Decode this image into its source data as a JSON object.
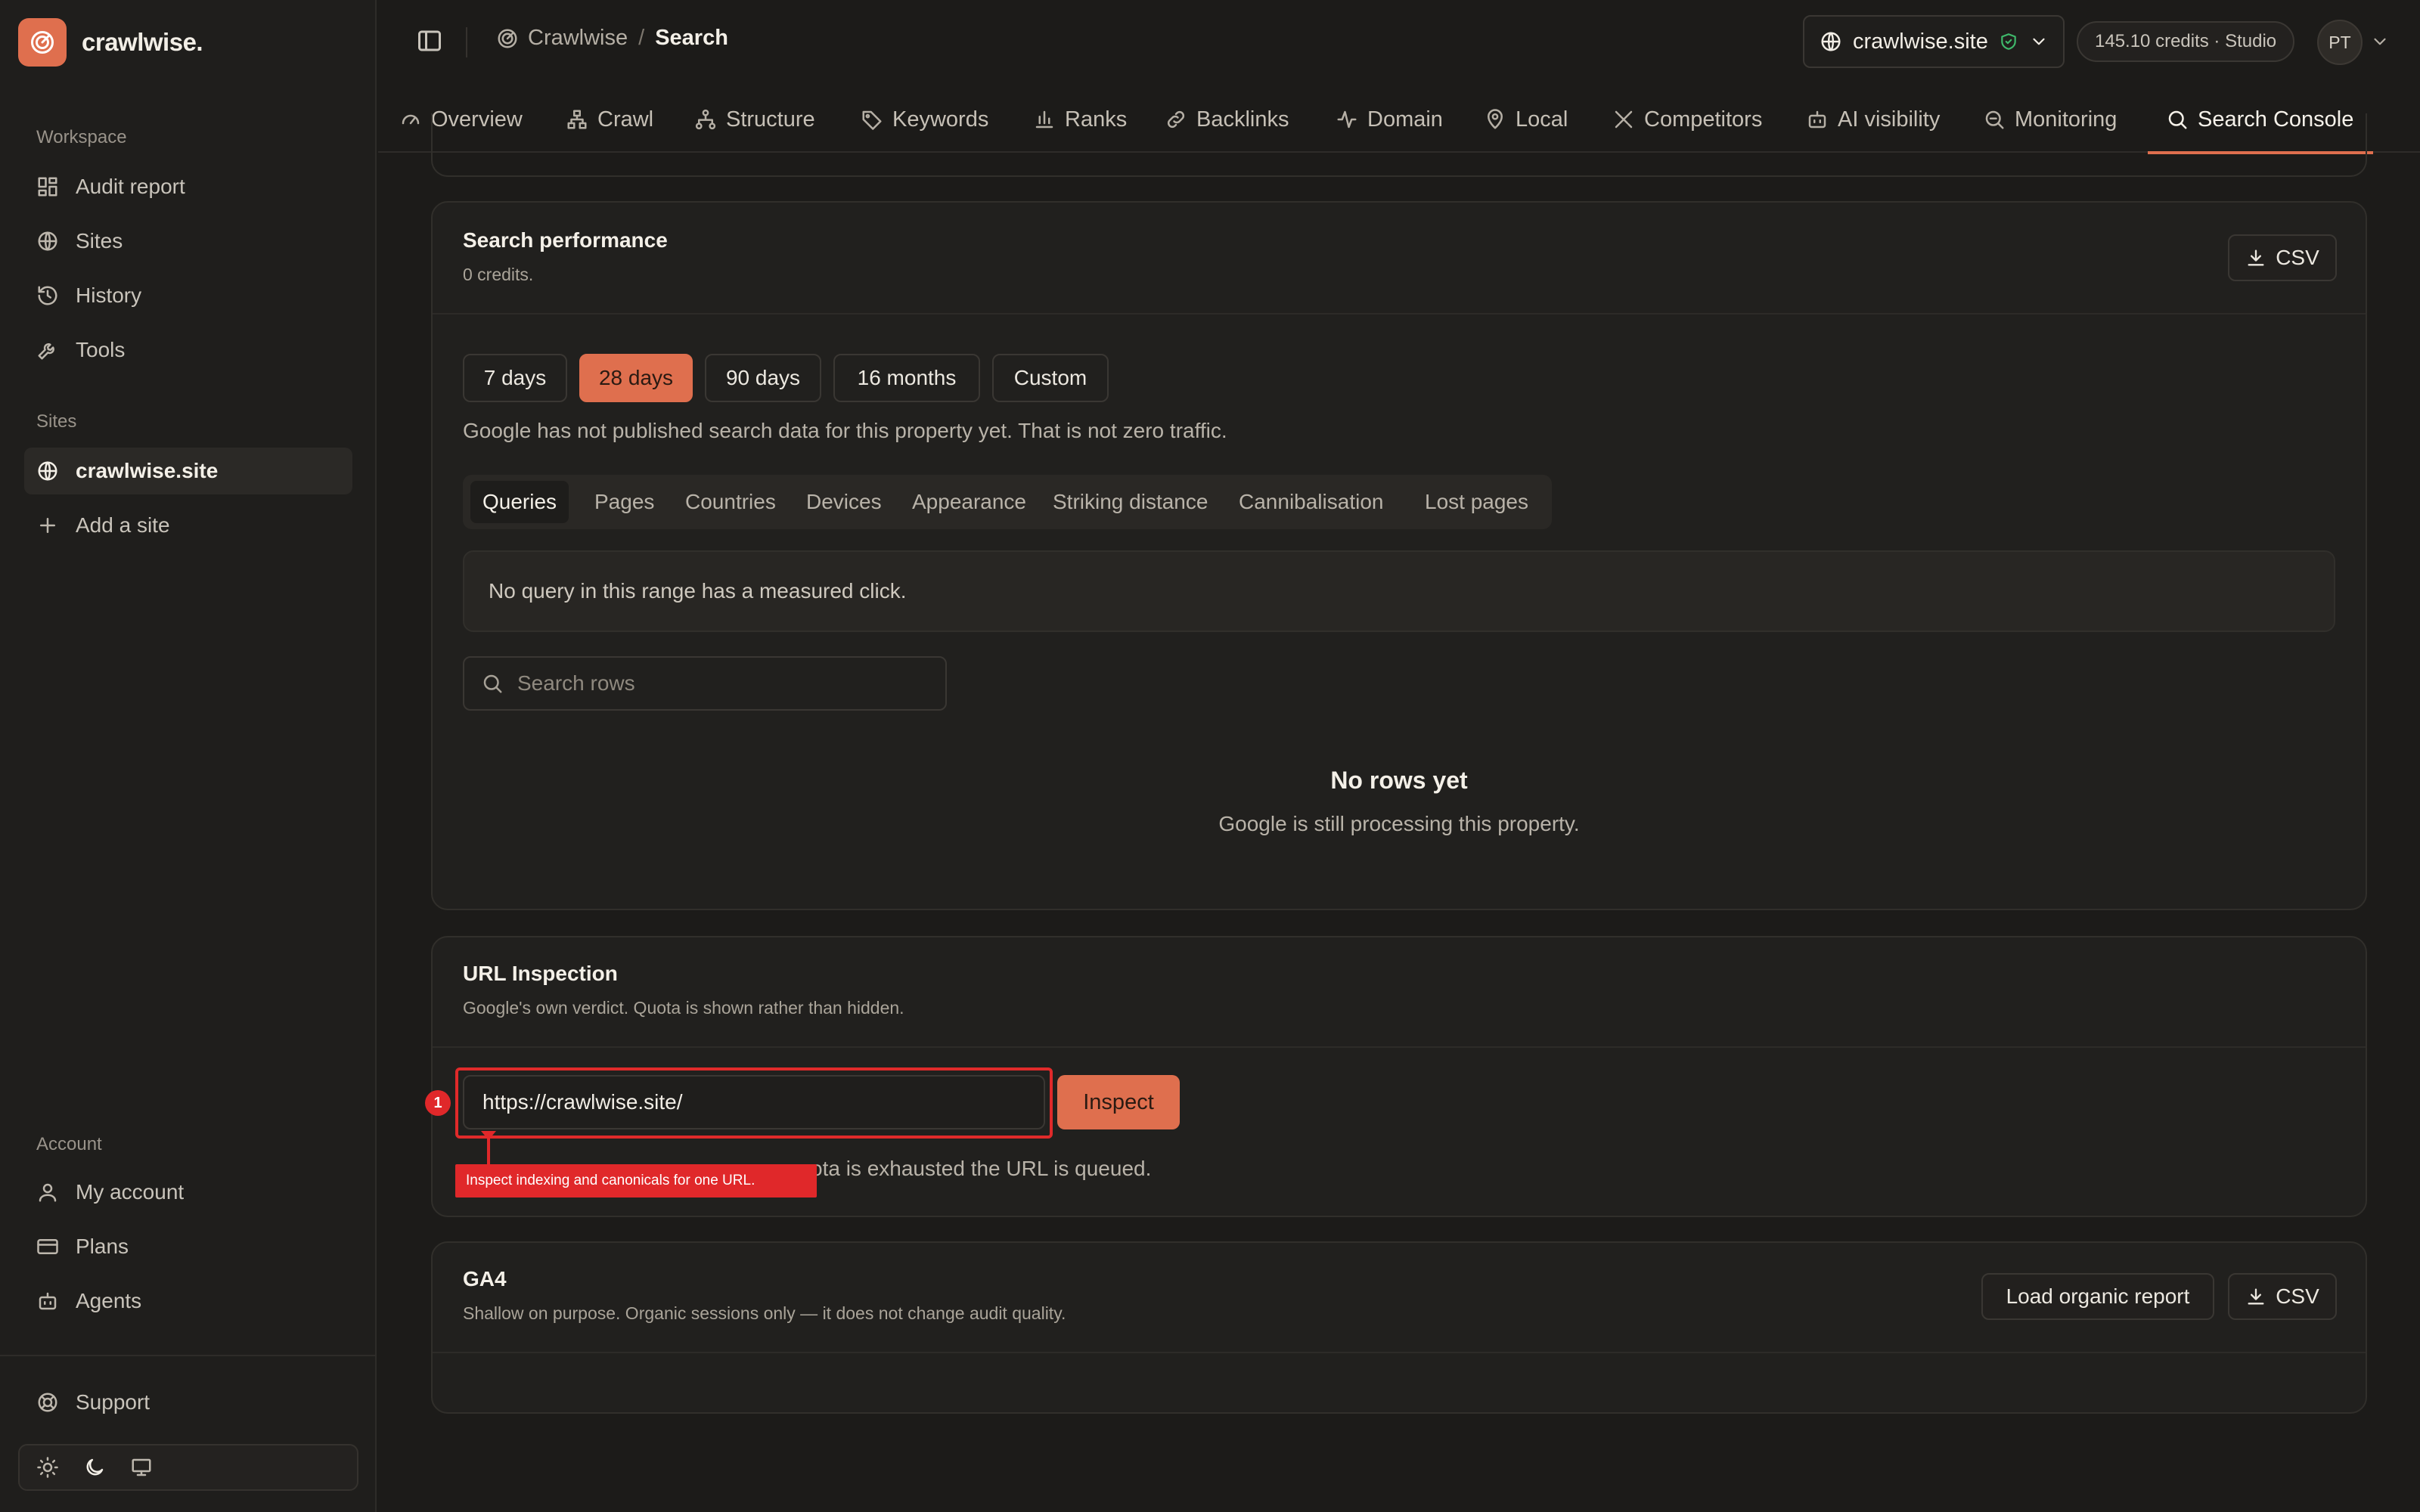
{
  "brand": {
    "name": "crawlwise."
  },
  "sidebar": {
    "workspace_label": "Workspace",
    "workspace_items": [
      {
        "label": "Audit report",
        "icon": "grid-icon"
      },
      {
        "label": "Sites",
        "icon": "globe-icon"
      },
      {
        "label": "History",
        "icon": "history-icon"
      },
      {
        "label": "Tools",
        "icon": "wrench-icon"
      }
    ],
    "sites_label": "Sites",
    "site_items": [
      {
        "label": "crawlwise.site",
        "icon": "globe-icon",
        "active": true
      },
      {
        "label": "Add a site",
        "icon": "plus-icon"
      }
    ],
    "account_label": "Account",
    "account_items": [
      {
        "label": "My account",
        "icon": "user-icon"
      },
      {
        "label": "Plans",
        "icon": "credit-card-icon"
      },
      {
        "label": "Agents",
        "icon": "bot-icon"
      }
    ],
    "support_label": "Support",
    "theme": {
      "options": [
        "sun-icon",
        "moon-icon",
        "monitor-icon"
      ],
      "selected": "moon-icon"
    }
  },
  "topbar": {
    "breadcrumb_root": "Crawlwise",
    "breadcrumb_sep": "/",
    "breadcrumb_current": "Search",
    "site_selector": "crawlwise.site",
    "credits": "145.10 credits · Studio",
    "avatar_initials": "PT"
  },
  "tabs": [
    {
      "label": "Overview",
      "icon": "gauge-icon"
    },
    {
      "label": "Crawl",
      "icon": "network-icon"
    },
    {
      "label": "Structure",
      "icon": "structure-icon"
    },
    {
      "label": "Keywords",
      "icon": "tag-icon"
    },
    {
      "label": "Ranks",
      "icon": "bar-chart-icon"
    },
    {
      "label": "Backlinks",
      "icon": "link-icon"
    },
    {
      "label": "Domain",
      "icon": "activity-icon"
    },
    {
      "label": "Local",
      "icon": "map-pin-icon"
    },
    {
      "label": "Competitors",
      "icon": "swords-icon"
    },
    {
      "label": "AI visibility",
      "icon": "bot-icon"
    },
    {
      "label": "Monitoring",
      "icon": "search-scan-icon"
    },
    {
      "label": "Search Console",
      "icon": "search-icon",
      "active": true
    }
  ],
  "search_performance": {
    "title": "Search performance",
    "subtitle": "0 credits.",
    "csv_label": "CSV",
    "ranges": [
      "7 days",
      "28 days",
      "90 days",
      "16 months",
      "Custom"
    ],
    "selected_range": "28 days",
    "notice": "Google has not published search data for this property yet. That is not zero traffic.",
    "sub_tabs": [
      "Queries",
      "Pages",
      "Countries",
      "Devices",
      "Appearance",
      "Striking distance",
      "Cannibalisation",
      "Lost pages"
    ],
    "selected_sub_tab": "Queries",
    "empty_banner": "No query in this range has a measured click.",
    "search_placeholder": "Search rows",
    "empty_title": "No rows yet",
    "empty_subtitle": "Google is still processing this property."
  },
  "url_inspection": {
    "title": "URL Inspection",
    "subtitle": "Google's own verdict. Quota is shown rather than hidden.",
    "url_value": "https://crawlwise.site/",
    "inspect_label": "Inspect",
    "quota_note_visible": "ota is exhausted the URL is queued.",
    "annotation_number": "1",
    "tooltip": "Inspect indexing and canonicals for one URL."
  },
  "ga4": {
    "title": "GA4",
    "subtitle": "Shallow on purpose. Organic sessions only — it does not change audit quality.",
    "load_label": "Load organic report",
    "csv_label": "CSV"
  },
  "colors": {
    "accent": "#df6f4e",
    "background": "#1c1b19",
    "annotation": "#e0282a",
    "success": "#3fb96b"
  }
}
